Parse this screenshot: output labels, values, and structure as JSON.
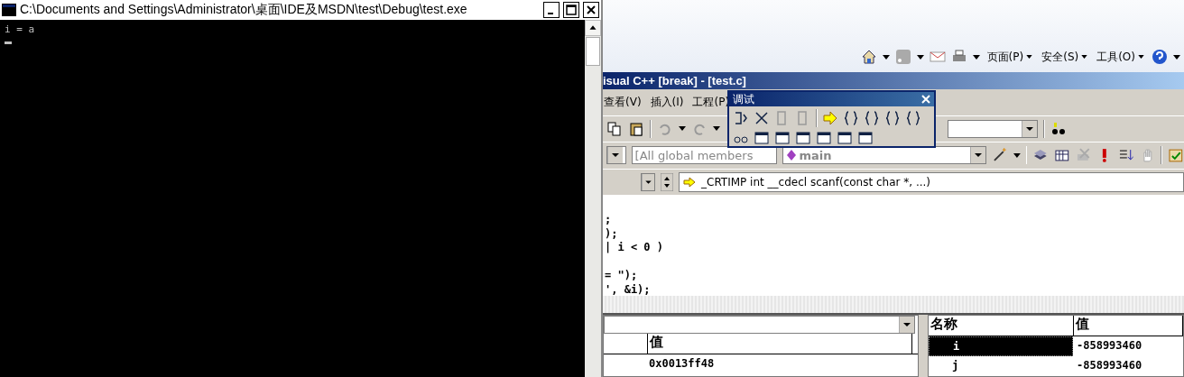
{
  "console": {
    "title": "C:\\Documents and Settings\\Administrator\\桌面\\IDE及MSDN\\test\\Debug\\test.exe",
    "lines": [
      "i = a"
    ]
  },
  "browser_toolbar": {
    "menus": [
      "页面(P)",
      "安全(S)",
      "工具(O)"
    ]
  },
  "ide": {
    "title": "isual C++ [break] - [test.c]",
    "menu": [
      "查看(V)",
      "插入(I)",
      "工程(P)"
    ],
    "scope_combo": "[All global members",
    "function_combo": "main",
    "context_field": "_CRTIMP int __cdecl scanf(const char *, ...)",
    "code_lines": [
      {
        "kind": "code",
        "text": ";"
      },
      {
        "kind": "code",
        "text": ");"
      },
      {
        "kind": "code",
        "text": "| i < 0 )"
      },
      {
        "kind": "blank"
      },
      {
        "kind": "code",
        "text": "= \");"
      },
      {
        "kind": "code",
        "text": "', &i);"
      }
    ],
    "variables": {
      "value_header": "值",
      "rows": [
        {
          "value": "0x0013ff48"
        }
      ]
    },
    "watch": {
      "columns": [
        "名称",
        "值"
      ],
      "rows": [
        {
          "name": "i",
          "value": "-858993460",
          "selected": true
        },
        {
          "name": "j",
          "value": "-858993460",
          "selected": false
        }
      ]
    }
  },
  "debug_toolbar": {
    "title": "调试"
  }
}
